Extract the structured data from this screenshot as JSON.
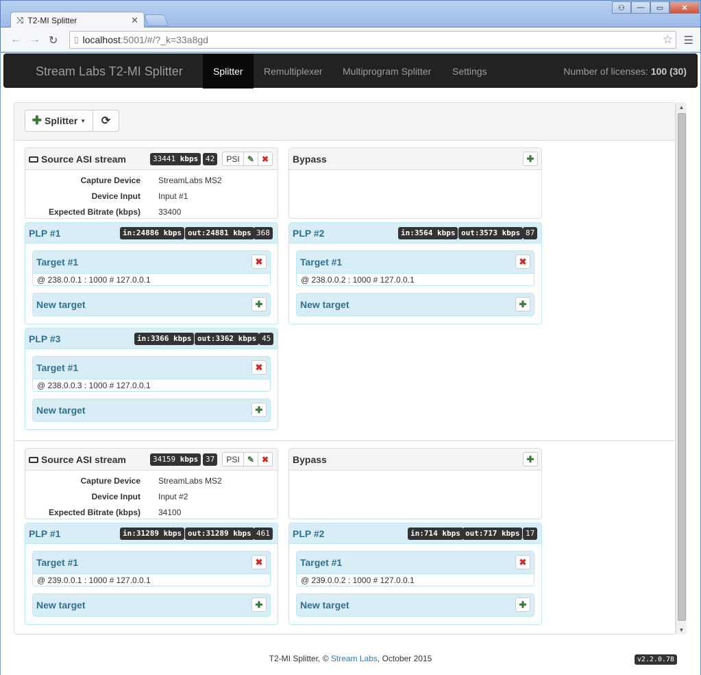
{
  "browser": {
    "tab_title": "T2-MI Splitter",
    "tab_icon": "shuffle-icon",
    "url_host": "localhost",
    "url_path": ":5001/#/?_k=33a8gd"
  },
  "navbar": {
    "brand": "Stream Labs T2-MI Splitter",
    "items": [
      "Splitter",
      "Remultiplexer",
      "Multiprogram Splitter",
      "Settings"
    ],
    "active": "Splitter",
    "licenses_label": "Number of licenses:",
    "licenses_value": "100 (30)"
  },
  "toolbar": {
    "splitter_label": "Splitter",
    "refresh_icon": "refresh-icon"
  },
  "streams": [
    {
      "source_title": "Source ASI stream",
      "bitrate_badge": "33441",
      "bitrate_unit": "kbps",
      "count_badge": "42",
      "psi_label": "PSI",
      "info": [
        {
          "label": "Capture Device",
          "value": "StreamLabs MS2"
        },
        {
          "label": "Device Input",
          "value": "Input #1"
        },
        {
          "label": "Expected Bitrate (kbps)",
          "value": "33400"
        }
      ],
      "bypass_title": "Bypass",
      "plps": [
        {
          "title": "PLP #1",
          "in": "in:24886",
          "out": "out:24881",
          "unit": "kbps",
          "count": "368",
          "targets": [
            {
              "title": "Target #1",
              "detail": "@ 238.0.0.1 : 1000 # 127.0.0.1"
            }
          ],
          "new_target": "New target"
        },
        {
          "title": "PLP #2",
          "in": "in:3564",
          "out": "out:3573",
          "unit": "kbps",
          "count": "87",
          "targets": [
            {
              "title": "Target #1",
              "detail": "@ 238.0.0.2 : 1000 # 127.0.0.1"
            }
          ],
          "new_target": "New target"
        },
        {
          "title": "PLP #3",
          "in": "in:3366",
          "out": "out:3362",
          "unit": "kbps",
          "count": "45",
          "targets": [
            {
              "title": "Target #1",
              "detail": "@ 238.0.0.3 : 1000 # 127.0.0.1"
            }
          ],
          "new_target": "New target"
        }
      ]
    },
    {
      "source_title": "Source ASI stream",
      "bitrate_badge": "34159",
      "bitrate_unit": "kbps",
      "count_badge": "37",
      "psi_label": "PSI",
      "info": [
        {
          "label": "Capture Device",
          "value": "StreamLabs MS2"
        },
        {
          "label": "Device Input",
          "value": "Input #2"
        },
        {
          "label": "Expected Bitrate (kbps)",
          "value": "34100"
        }
      ],
      "bypass_title": "Bypass",
      "plps": [
        {
          "title": "PLP #1",
          "in": "in:31289",
          "out": "out:31289",
          "unit": "kbps",
          "count": "461",
          "targets": [
            {
              "title": "Target #1",
              "detail": "@ 239.0.0.1 : 1000 # 127.0.0.1"
            }
          ],
          "new_target": "New target"
        },
        {
          "title": "PLP #2",
          "in": "in:714",
          "out": "out:717",
          "unit": "kbps",
          "count": "17",
          "targets": [
            {
              "title": "Target #1",
              "detail": "@ 239.0.0.2 : 1000 # 127.0.0.1"
            }
          ],
          "new_target": "New target"
        }
      ]
    }
  ],
  "footer": {
    "prefix": "T2-MI Splitter, © ",
    "link": "Stream Labs",
    "suffix": ", October 2015",
    "version": "v2.2.0.78"
  }
}
